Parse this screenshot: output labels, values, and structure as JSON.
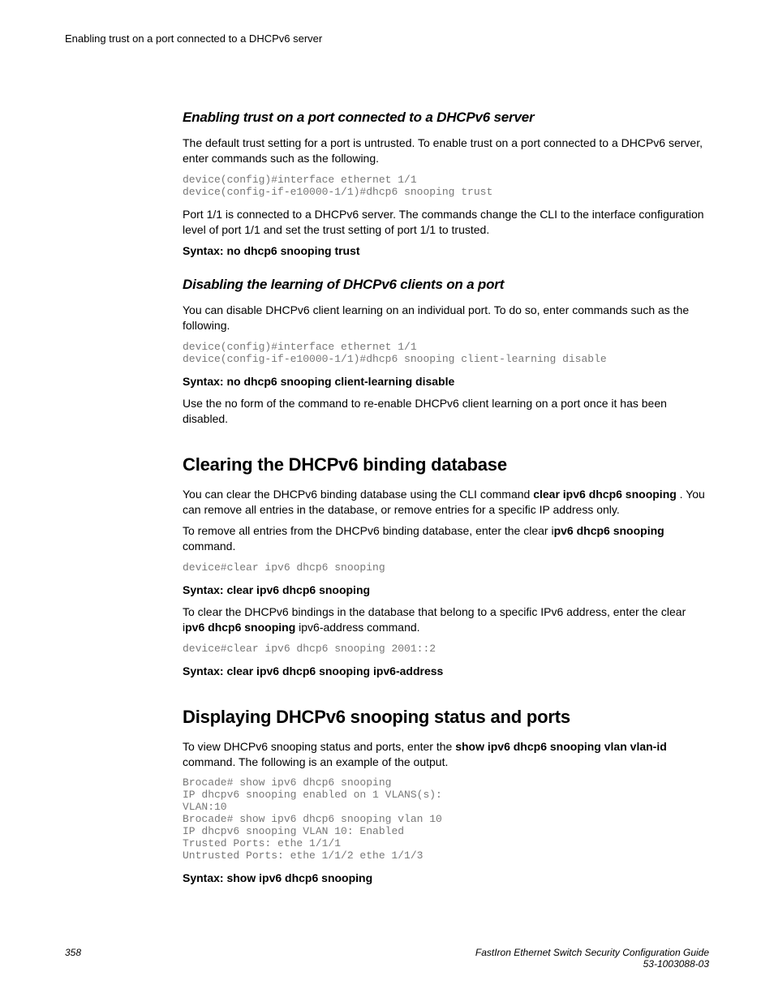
{
  "runningHeader": "Enabling trust on a port connected to a DHCPv6 server",
  "section1": {
    "heading": "Enabling trust on a port connected to a DHCPv6 server",
    "p1": "The default trust setting for a port is untrusted. To enable trust on a port connected to a DHCPv6 server, enter commands such as the following.",
    "code1": "device(config)#interface ethernet 1/1\ndevice(config-if-e10000-1/1)#dhcp6 snooping trust",
    "p2": "Port 1/1 is connected to a DHCPv6 server. The commands change the CLI to the interface configuration level of port 1/1 and set the trust setting of port 1/1 to trusted.",
    "syntax": "Syntax: no dhcp6 snooping trust"
  },
  "section2": {
    "heading": "Disabling the learning of DHCPv6 clients on a port",
    "p1": "You can disable DHCPv6 client learning on an individual port. To do so, enter commands such as the following.",
    "code1": "device(config)#interface ethernet 1/1\ndevice(config-if-e10000-1/1)#dhcp6 snooping client-learning disable",
    "syntax": "Syntax: no dhcp6 snooping client-learning disable",
    "p2": "Use the no form of the command to re-enable DHCPv6 client learning on a port once it has been disabled."
  },
  "section3": {
    "heading": "Clearing the DHCPv6 binding database",
    "p1a": "You can clear the DHCPv6 binding database using the CLI command ",
    "p1b": "clear ipv6 dhcp6 snooping",
    "p1c": " . You can remove all entries in the database, or remove entries for a specific IP address only.",
    "p2a": "To remove all entries from the DHCPv6 binding database, enter the clear i",
    "p2b": "pv6 dhcp6 snooping",
    "p2c": " command.",
    "code1": "device#clear ipv6 dhcp6 snooping",
    "syntax1": "Syntax: clear ipv6 dhcp6 snooping",
    "p3a": "To clear the DHCPv6 bindings in the database that belong to a specific IPv6 address, enter the clear i",
    "p3b": "pv6 dhcp6 snooping",
    "p3c": " ipv6-address command.",
    "code2": "device#clear ipv6 dhcp6 snooping 2001::2",
    "syntax2": "Syntax: clear ipv6 dhcp6 snooping ipv6-address"
  },
  "section4": {
    "heading": "Displaying DHCPv6 snooping status and ports",
    "p1a": "To view DHCPv6 snooping status and ports, enter the ",
    "p1b": "show ipv6 dhcp6 snooping vlan vlan-id",
    "p1c": " command. The following is an example of the output.",
    "code1": "Brocade# show ipv6 dhcp6 snooping\nIP dhcpv6 snooping enabled on 1 VLANS(s):\nVLAN:10\nBrocade# show ipv6 dhcp6 snooping vlan 10\nIP dhcpv6 snooping VLAN 10: Enabled\nTrusted Ports: ethe 1/1/1\nUntrusted Ports: ethe 1/1/2 ethe 1/1/3",
    "syntax": "Syntax: show ipv6 dhcp6 snooping"
  },
  "footer": {
    "pageNumber": "358",
    "title": "FastIron Ethernet Switch Security Configuration Guide",
    "docId": "53-1003088-03"
  }
}
